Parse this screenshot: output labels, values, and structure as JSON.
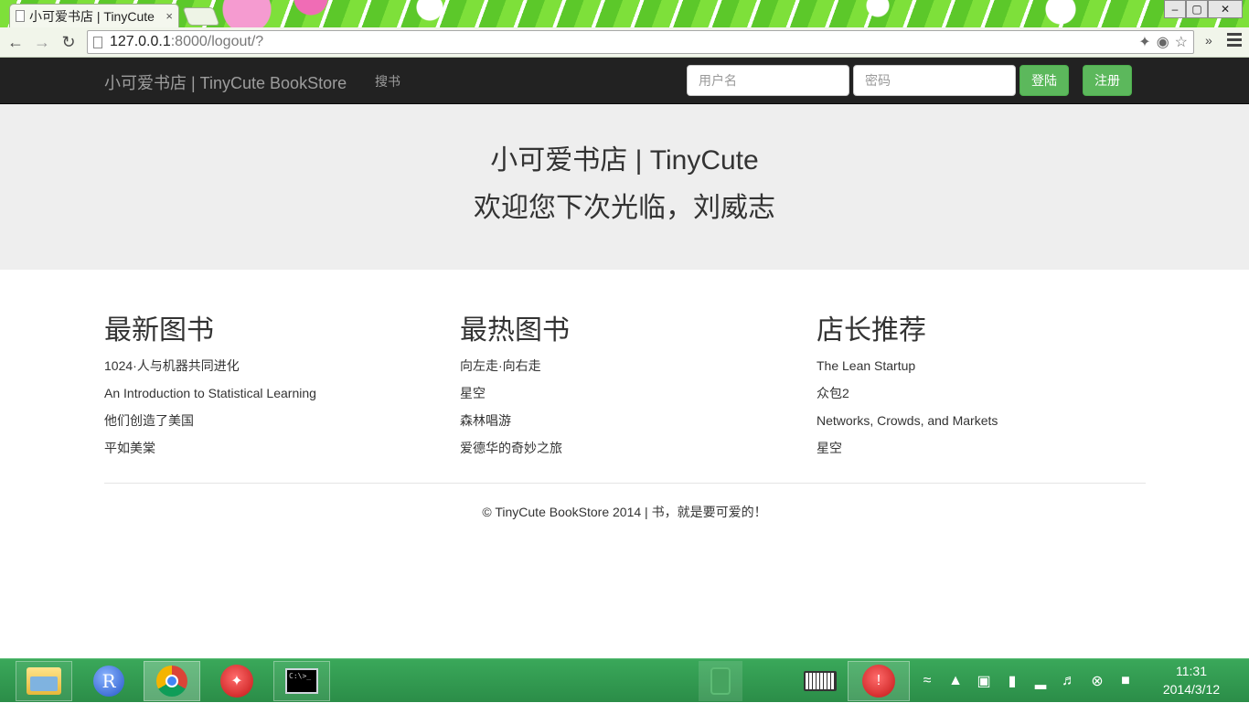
{
  "browser": {
    "tab_title": "小可爱书店 | TinyCute",
    "tab_close": "×",
    "url_host": "127.0.0.1",
    "url_path": ":8000/logout/?",
    "window_min": "–",
    "window_max": "▢",
    "window_close": "✕",
    "ext_more": "»"
  },
  "navbar": {
    "brand": "小可爱书店 | TinyCute BookStore",
    "search_link": "搜书",
    "username_placeholder": "用户名",
    "password_placeholder": "密码",
    "login_label": "登陆",
    "register_label": "注册"
  },
  "jumbotron": {
    "title": "小可爱书店 | TinyCute",
    "subtitle": "欢迎您下次光临，刘威志"
  },
  "columns": [
    {
      "heading": "最新图书",
      "items": [
        "1024·人与机器共同进化",
        "An Introduction to Statistical Learning",
        "他们创造了美国",
        "平如美棠"
      ]
    },
    {
      "heading": "最热图书",
      "items": [
        "向左走·向右走",
        "星空",
        "森林唱游",
        "爱德华的奇妙之旅"
      ]
    },
    {
      "heading": "店长推荐",
      "items": [
        "The Lean Startup",
        "众包2",
        "Networks, Crowds, and Markets",
        "星空"
      ]
    }
  ],
  "footer": {
    "text": "© TinyCute BookStore 2014 | 书，就是要可爱的！"
  },
  "taskbar": {
    "r_icon_label": "R",
    "cmd_icon_label": "C:\\>_",
    "clock_time": "11:31",
    "clock_date": "2014/3/12"
  },
  "colors": {
    "navbar_bg": "#222222",
    "jumbotron_bg": "#eeeeee",
    "button_green": "#5cb85c",
    "taskbar_green": "#2f9a4f"
  }
}
